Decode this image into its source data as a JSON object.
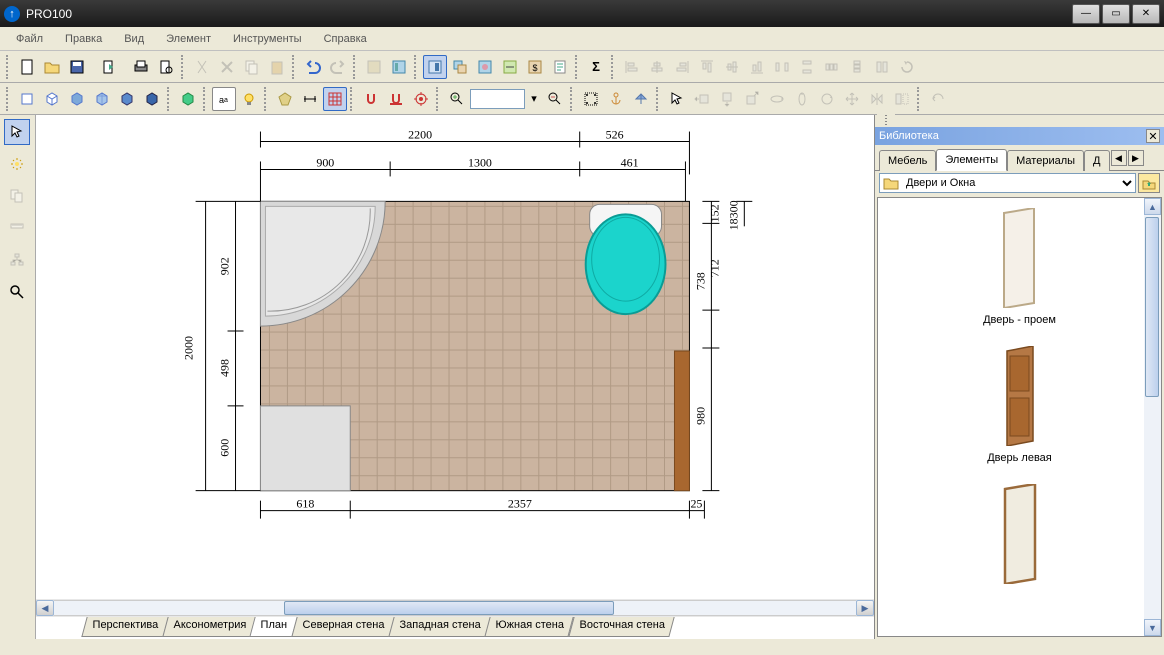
{
  "app": {
    "title": "PRO100"
  },
  "menu": [
    "Файл",
    "Правка",
    "Вид",
    "Элемент",
    "Инструменты",
    "Справка"
  ],
  "toolbar_zoom": {
    "value": ""
  },
  "views": [
    "Перспектива",
    "Аксонометрия",
    "План",
    "Северная стена",
    "Западная стена",
    "Южная стена",
    "Восточная стена"
  ],
  "active_view": "План",
  "library": {
    "title": "Библиотека",
    "tabs": [
      "Мебель",
      "Элементы",
      "Материалы",
      "Д"
    ],
    "active_tab": "Элементы",
    "path": "Двери и Окна",
    "items": [
      {
        "label": "Дверь - проем",
        "type": "frame"
      },
      {
        "label": "Дверь левая",
        "type": "brown-door"
      },
      {
        "label": "",
        "type": "frame-door"
      }
    ]
  },
  "dimensions": {
    "top_outer_left": "2200",
    "top_outer_right": "526",
    "top_inner_1": "900",
    "top_inner_2": "1300",
    "top_inner_3": "461",
    "left_outer": "2000",
    "left_inner_1": "902",
    "left_inner_2": "498",
    "left_inner_3": "600",
    "right_inner_1": "152",
    "right_inner_2": "712",
    "right_inner_3": "738",
    "right_inner_4": "980",
    "right_outer": "18300",
    "bottom_1": "618",
    "bottom_2": "2357",
    "bottom_3": "25"
  },
  "colors": {
    "tile": "#c9b39d",
    "toilet_seat": "#1bd4cc",
    "door": "#a8672f"
  }
}
